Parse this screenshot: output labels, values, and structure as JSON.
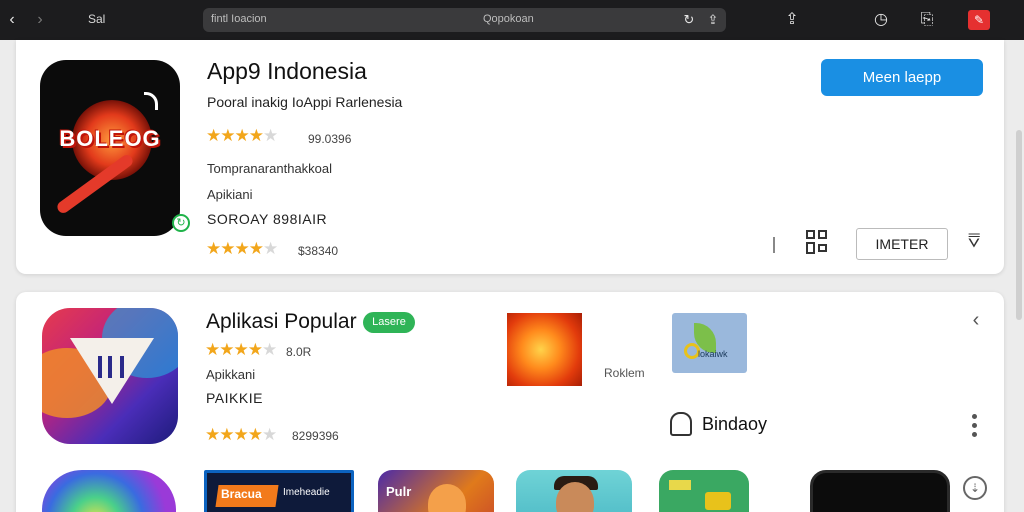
{
  "browser": {
    "back_icon": "chevron-left-icon",
    "forward_icon": "chevron-right-icon",
    "brand_label": "Sal",
    "url_left": "fintl Ioacion",
    "url_center": "Qopokoan",
    "reload_icon": "reload-icon",
    "share_icon": "share-icon"
  },
  "featured_app": {
    "title": "App9 Indonesia",
    "subtitle": "Pooral inakig IoAppi Rarlenesia",
    "rating_value": "99.0396",
    "meta_line": "Tompranaranthakkoal",
    "category": "Apikiani",
    "developer": "SOROAY 898IAIR",
    "rating_value_2": "$38340",
    "icon_word": "BOLEOG",
    "install_button": "Meen laepp",
    "outline_button": "IMETER",
    "rating_stars": 4.0,
    "rating_stars_2": 4.0
  },
  "popular_section": {
    "title": "Aplikasi Popular",
    "badge": "Lasere",
    "rating_value": "8.0R",
    "category": "Apikkani",
    "developer": "PAIKKIE",
    "rating_value_2": "8299396",
    "thumb2_caption": "lokaiwk",
    "side_label": "Roklem",
    "follow_label": "Bindaoy",
    "rating_stars": 4.5,
    "rating_stars_2": 4.5
  },
  "bottom_thumbs": {
    "thumb2_title": "Bracua",
    "thumb2_sub": "Imeheadie",
    "thumb3_title": "Pulr"
  }
}
